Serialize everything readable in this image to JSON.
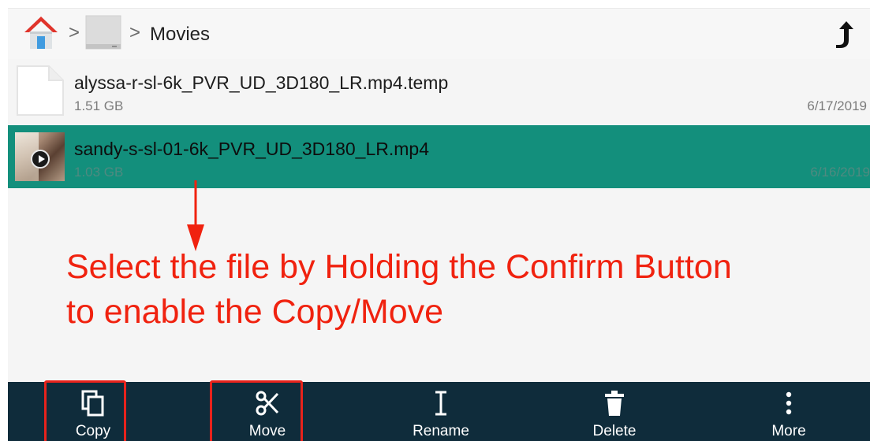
{
  "header": {
    "path_label": "Movies"
  },
  "files": [
    {
      "name": "alyssa-r-sl-6k_PVR_UD_3D180_LR.mp4.temp",
      "size": "1.51 GB",
      "date": "6/17/2019",
      "icon": "document-icon",
      "selected": false
    },
    {
      "name": "sandy-s-sl-01-6k_PVR_UD_3D180_LR.mp4",
      "size": "1.03 GB",
      "date": "6/16/2019",
      "icon": "video-thumbnail",
      "selected": true
    }
  ],
  "annotation": {
    "line1": "Select the file by Holding the Confirm Button",
    "line2": "to enable the Copy/Move"
  },
  "toolbar": {
    "items": [
      {
        "label": "Copy",
        "icon": "copy-icon"
      },
      {
        "label": "Move",
        "icon": "scissors-icon"
      },
      {
        "label": "Rename",
        "icon": "text-cursor-icon"
      },
      {
        "label": "Delete",
        "icon": "trash-icon"
      },
      {
        "label": "More",
        "icon": "more-vertical-icon"
      }
    ]
  },
  "colors": {
    "selected_row": "#138f7c",
    "toolbar_bg": "#0f2c3b",
    "annotation": "#f0220f",
    "highlight_box": "#e8231c"
  }
}
